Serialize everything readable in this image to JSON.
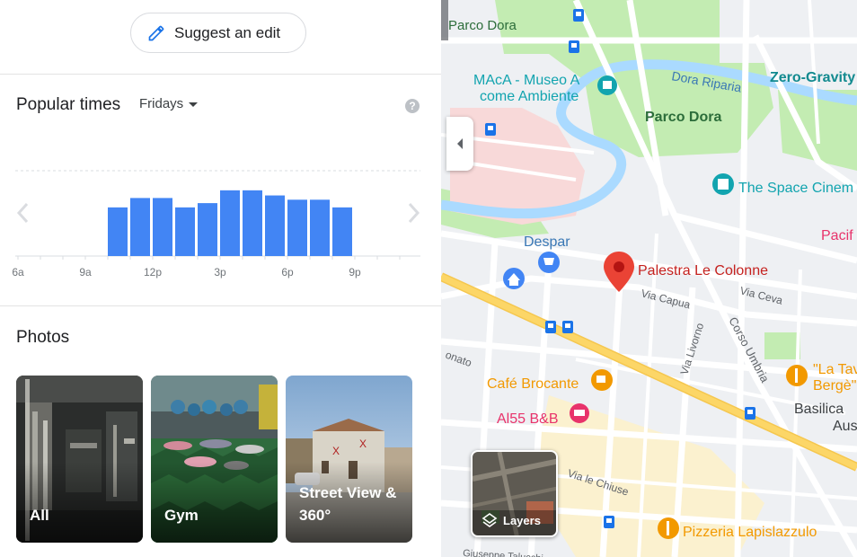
{
  "panel": {
    "suggest_edit_label": "Suggest an edit",
    "popular_times": {
      "title": "Popular times",
      "day": "Fridays",
      "help": "?"
    },
    "photos": {
      "title": "Photos",
      "items": [
        {
          "label": "All"
        },
        {
          "label": "Gym"
        },
        {
          "label": "Street View &\n360°"
        }
      ]
    }
  },
  "chart_data": {
    "type": "bar",
    "title": "Popular times",
    "categories": [
      "6a",
      "7a",
      "8a",
      "9a",
      "10a",
      "11a",
      "12p",
      "1p",
      "2p",
      "3p",
      "4p",
      "5p",
      "6p",
      "7p",
      "8p",
      "9p",
      "10p",
      "11p"
    ],
    "series": [
      {
        "values": [
          0,
          0,
          0,
          0,
          57,
          68,
          68,
          57,
          62,
          77,
          77,
          71,
          66,
          66,
          57,
          0,
          0,
          0
        ]
      }
    ],
    "tick_labels": [
      "6a",
      "9a",
      "12p",
      "3p",
      "6p",
      "9p"
    ],
    "ylim": [
      0,
      100
    ],
    "color": "#4285f4"
  },
  "map": {
    "labels": {
      "parco_dora_top": "Parco Dora",
      "maca_line1": "MAcA - Museo A",
      "maca_line2": "come Ambiente",
      "dora_riparia": "Dora Riparia",
      "parco_dora": "Parco Dora",
      "zero_gravity": "Zero-Gravity",
      "space_cinema": "The Space Cinem",
      "despar": "Despar",
      "pacif": "Pacif",
      "palestra": "Palestra Le Colonne",
      "via_capua": "Via Capua",
      "via_ceva": "Via Ceva",
      "corso_umbria": "Corso Umbria",
      "via_livorno": "Via Livorno",
      "donato": "onato",
      "la_tav_line1": "\"La Tav",
      "la_tav_line2": "Bergè\"",
      "cafe": "Café Brocante",
      "al55": "Al55 B&B",
      "basilica_line1": "Basilica",
      "basilica_line2": "Aus",
      "via_le_chiuse": "Via le Chiuse",
      "pizzeria": "Pizzeria Lapislazzulo",
      "talucchi": "Giuseppe Talucchi"
    },
    "layers_label": "Layers",
    "colors": {
      "pin": "#ea4335",
      "park": "#c3ecb2",
      "water": "#aadaff",
      "road_major": "#fcd667",
      "food": "#f29900",
      "transit": "#1a73e8",
      "lodging": "#e8336b",
      "museum": "#12a4af"
    }
  }
}
